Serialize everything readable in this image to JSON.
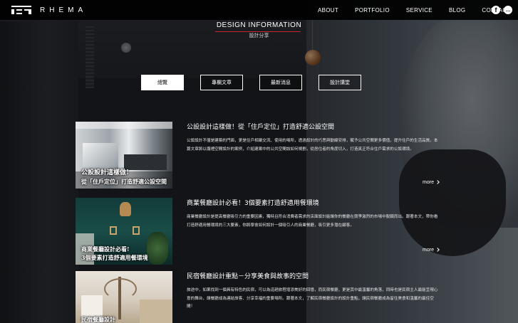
{
  "header": {
    "logo_text": "RHEMA",
    "nav": [
      "ABOUT",
      "PORTFOLIO",
      "SERVICE",
      "BLOG",
      "CONTACT"
    ],
    "social": [
      {
        "name": "facebook-icon",
        "glyph": "f"
      },
      {
        "name": "line-icon",
        "glyph": "…"
      }
    ]
  },
  "section": {
    "title_en": "DESIGN INFORMATION",
    "title_zh": "設計分享",
    "accent": "#c4262e"
  },
  "tabs": [
    {
      "label": "總覽",
      "active": true
    },
    {
      "label": "專欄文章",
      "active": false
    },
    {
      "label": "最新消息",
      "active": false
    },
    {
      "label": "設計講堂",
      "active": false
    }
  ],
  "posts": [
    {
      "title": "公設設計這樣做！從「住戶定位」打造舒適公設空間",
      "excerpt": "公設設計不僅是建築的門面，更是住戶相聚交流、使用的場所，透過設計的巧思與動線安排，賦予公共空間更多價值，提升住戶的生活品質。本篇文章將以攏禮空間設計的案例，介紹建案中的公共空間該如何規劃，從居住者的角度切入，打造真正符合住戶需求的公設環境。",
      "thumb_caption": [
        "公設設計這樣做!",
        "從「住戶定位」打造舒適公設空間"
      ],
      "more": "more"
    },
    {
      "title": "商業餐廳設計必看！3個要素打造舒適用餐環境",
      "excerpt": "商業餐廳設計是提高餐廳吸引力的重要因素，獨特且符合消費者需求的店面設計能讓你的餐廳在競爭激烈的市場中脫穎而出。跟著本文，帶你看打造舒適用餐環境的三大要素，你將學會如何設計一個吸引人的商業餐廳，吸引更多潛在顧客。",
      "thumb_caption": [
        "商業餐廳設計必看!",
        "3個要素打造舒適用餐環境"
      ],
      "more": "more"
    },
    {
      "title": "民宿餐廳設計重點－分享美食與故事的空間",
      "excerpt": "旅途中，如果找到一個具有特色的民宿，可以為這趟旅程增添美好的回憶，而民宿餐廳，更是其中最溫馨的角落，同時也是民宿主人最能呈現心意的舞台，讓餐廳成為連結旅客、分享幸福的重要場所。跟著本文，了解民宿餐廳設計的設計重點，讓民宿餐廳成為留住美食和溫馨的最佳空間！",
      "thumb_caption": [
        "民宿餐廳設計"
      ],
      "more": "more"
    }
  ]
}
